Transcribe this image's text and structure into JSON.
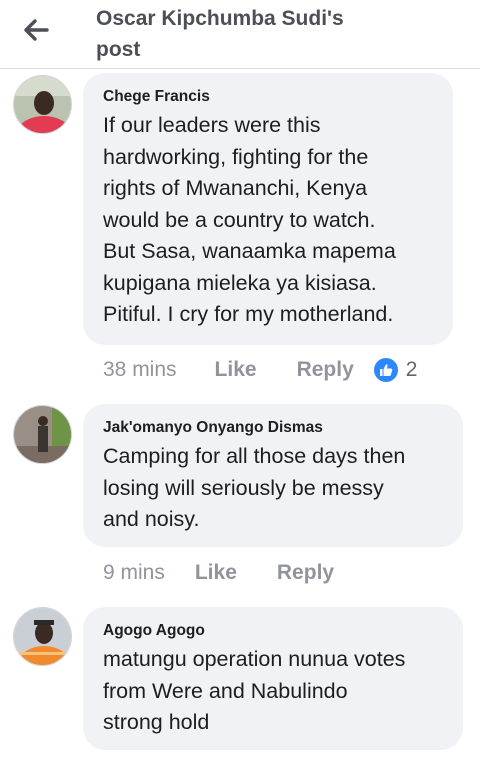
{
  "header": {
    "title_line1": "Oscar Kipchumba Sudi's",
    "title_line2": "post"
  },
  "icons": {
    "back": "arrow-left-icon",
    "reaction": "like-thumb-icon"
  },
  "colors": {
    "reaction_blue": "#2d88ff",
    "bubble_bg": "#f0f2f5"
  },
  "comments": [
    {
      "author": "Chege Francis",
      "lines": [
        "If our leaders were this",
        "hardworking, fighting for the",
        "rights of Mwananchi, Kenya",
        "would be a country to watch.",
        "But Sasa, wanaamka mapema",
        "kupigana mieleka ya kisiasa.",
        "Pitiful. I cry for my motherland."
      ],
      "time": "38 mins",
      "like_label": "Like",
      "reply_label": "Reply",
      "reaction_count": "2"
    },
    {
      "author": "Jak'omanyo Onyango Dismas",
      "lines": [
        "Camping for all those days then",
        "losing will seriously be messy",
        "and noisy."
      ],
      "time": "9 mins",
      "like_label": "Like",
      "reply_label": "Reply"
    },
    {
      "author": "Agogo Agogo",
      "lines": [
        "matungu operation nunua votes",
        "from Were and Nabulindo",
        "strong hold"
      ]
    }
  ]
}
